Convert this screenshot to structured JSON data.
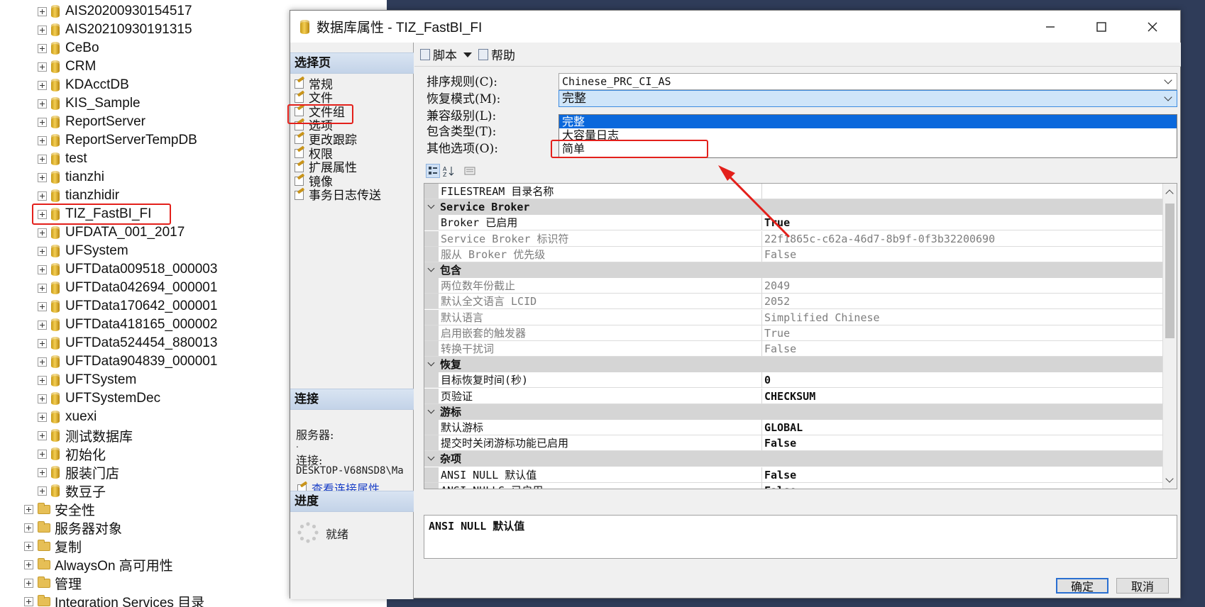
{
  "explorer": {
    "databases": [
      "AIS20200930154517",
      "AIS20210930191315",
      "CeBo",
      "CRM",
      "KDAcctDB",
      "KIS_Sample",
      "ReportServer",
      "ReportServerTempDB",
      "test",
      "tianzhi",
      "tianzhidir",
      "TIZ_FastBI_FI",
      "UFDATA_001_2017",
      "UFSystem",
      "UFTData009518_000003",
      "UFTData042694_000001",
      "UFTData170642_000001",
      "UFTData418165_000002",
      "UFTData524454_880013",
      "UFTData904839_000001",
      "UFTSystem",
      "UFTSystemDec",
      "xuexi",
      "测试数据库",
      "初始化",
      "服装门店",
      "数豆子"
    ],
    "folders": [
      "安全性",
      "服务器对象",
      "复制",
      "AlwaysOn 高可用性",
      "管理",
      "Integration Services 目录"
    ]
  },
  "dialog": {
    "title": "数据库属性 - TIZ_FastBI_FI",
    "select_page_header": "选择页",
    "pages": [
      "常规",
      "文件",
      "文件组",
      "选项",
      "更改跟踪",
      "权限",
      "扩展属性",
      "镜像",
      "事务日志传送"
    ],
    "connection_header": "连接",
    "server_label": "服务器:",
    "server_value": ".",
    "connection_label": "连接:",
    "connection_value": "DESKTOP-V68NSD8\\Ma",
    "view_connection_link": "查看连接属性",
    "progress_header": "进度",
    "progress_status": "就绪",
    "toolbar": {
      "script": "脚本",
      "help": "帮助"
    },
    "fields": {
      "collation_label": "排序规则(C):",
      "collation_value": "Chinese_PRC_CI_AS",
      "recovery_label": "恢复模式(M):",
      "recovery_value": "完整",
      "compat_label": "兼容级别(L):",
      "containment_label": "包含类型(T):",
      "other_label": "其他选项(O):"
    },
    "recovery_options": [
      "完整",
      "大容量日志",
      "简单"
    ],
    "grid": [
      {
        "type": "prop",
        "name": "FILESTREAM 目录名称",
        "value": "",
        "style": "normal"
      },
      {
        "type": "cat",
        "name": "Service Broker"
      },
      {
        "type": "prop",
        "name": "Broker 已启用",
        "value": "True",
        "style": "bold"
      },
      {
        "type": "prop",
        "name": "Service Broker 标识符",
        "value": "22f1865c-c62a-46d7-8b9f-0f3b32200690",
        "style": "dim"
      },
      {
        "type": "prop",
        "name": "服从 Broker 优先级",
        "value": "False",
        "style": "dim"
      },
      {
        "type": "cat",
        "name": "包含"
      },
      {
        "type": "prop",
        "name": "两位数年份截止",
        "value": "2049",
        "style": "dim"
      },
      {
        "type": "prop",
        "name": "默认全文语言 LCID",
        "value": "2052",
        "style": "dim"
      },
      {
        "type": "prop",
        "name": "默认语言",
        "value": "Simplified Chinese",
        "style": "dim"
      },
      {
        "type": "prop",
        "name": "启用嵌套的触发器",
        "value": "True",
        "style": "dim"
      },
      {
        "type": "prop",
        "name": "转换干扰词",
        "value": "False",
        "style": "dim"
      },
      {
        "type": "cat",
        "name": "恢复"
      },
      {
        "type": "prop",
        "name": "目标恢复时间(秒)",
        "value": "0",
        "style": "bold"
      },
      {
        "type": "prop",
        "name": "页验证",
        "value": "CHECKSUM",
        "style": "bold"
      },
      {
        "type": "cat",
        "name": "游标"
      },
      {
        "type": "prop",
        "name": "默认游标",
        "value": "GLOBAL",
        "style": "bold"
      },
      {
        "type": "prop",
        "name": "提交时关闭游标功能已启用",
        "value": "False",
        "style": "bold"
      },
      {
        "type": "cat",
        "name": "杂项"
      },
      {
        "type": "prop",
        "name": "ANSI NULL 默认值",
        "value": "False",
        "style": "bold"
      },
      {
        "type": "prop",
        "name": "ANSI NULLS 已启用",
        "value": "False",
        "style": "bold"
      }
    ],
    "description": "ANSI NULL 默认值",
    "ok_label": "确定",
    "cancel_label": "取消"
  },
  "colors": {
    "annotation": "#e3201b",
    "selection": "#0a68dc",
    "backdrop": "#2f3c59"
  }
}
